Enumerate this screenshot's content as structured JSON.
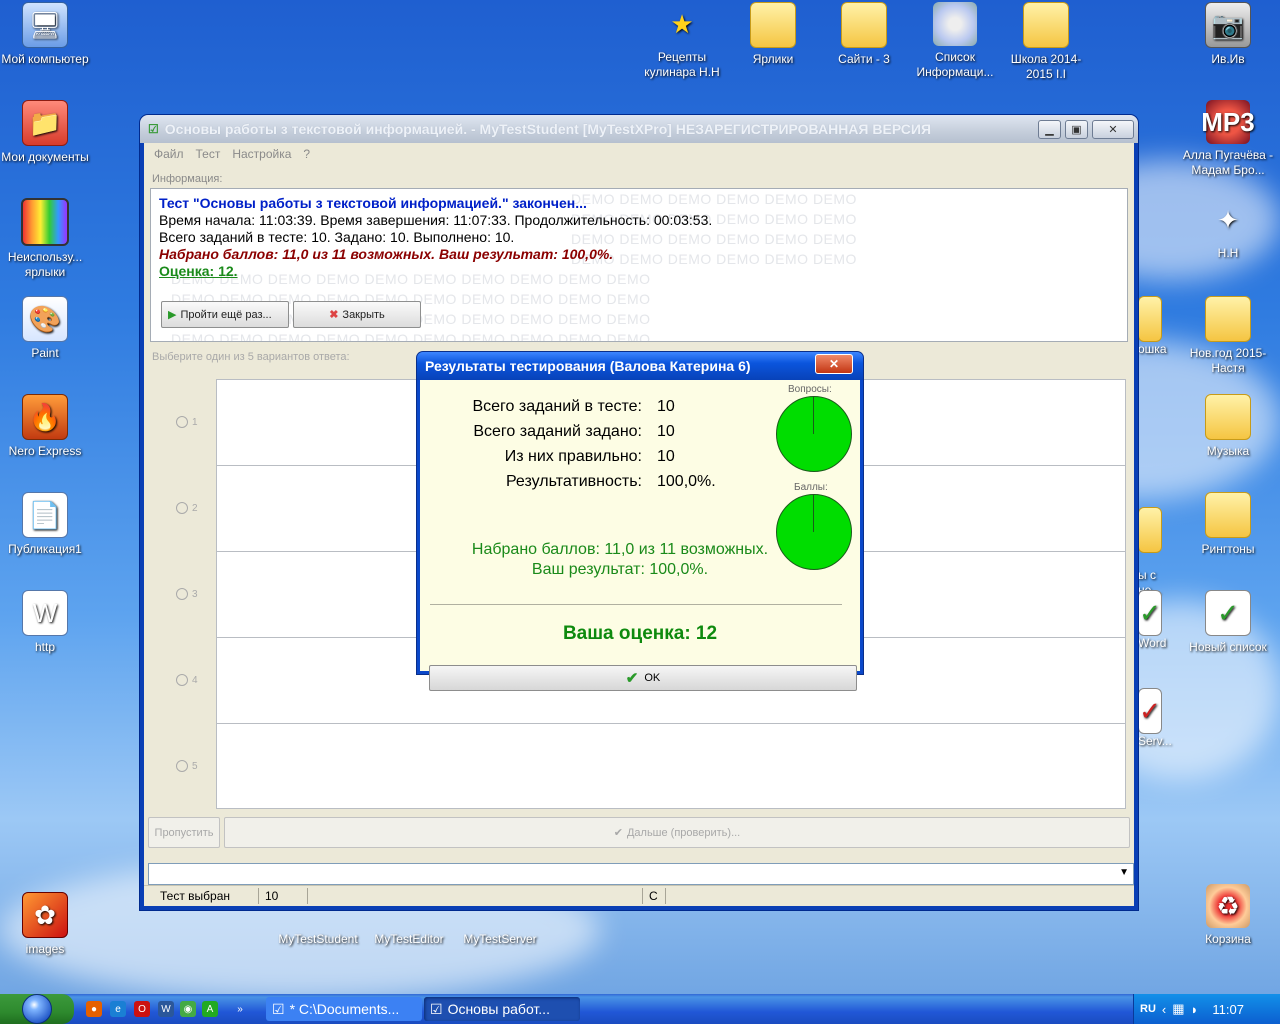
{
  "desktop": {
    "left_icons": [
      {
        "label": "Мой компьютер",
        "icon": "computer-icon"
      },
      {
        "label": "Мои документы",
        "icon": "my-documents-icon"
      },
      {
        "label": "Неиспользу... ярлыки",
        "icon": "unused-shortcuts-icon"
      },
      {
        "label": "Paint",
        "icon": "paint-icon"
      },
      {
        "label": "Nero Express",
        "icon": "nero-icon"
      },
      {
        "label": "Публикация1",
        "icon": "publisher-document-icon"
      },
      {
        "label": "http",
        "icon": "word-document-icon"
      },
      {
        "label": "images",
        "icon": "image-icon"
      }
    ],
    "top_icons": [
      {
        "label": "Рецепты кулинара Н.Н",
        "icon": "star-icon"
      },
      {
        "label": "Ярлики",
        "icon": "folder-icon"
      },
      {
        "label": "Сайти - 3",
        "icon": "folder-icon"
      },
      {
        "label": "Список Информаци...",
        "icon": "cd-icon"
      },
      {
        "label": "Школа 2014-2015 I.I",
        "icon": "folder-icon"
      }
    ],
    "right_icons": [
      {
        "label": "Ив.Ив",
        "icon": "camera-icon"
      },
      {
        "label": "Алла Пугачёва - Мадам Бро...",
        "icon": "mp3-icon"
      },
      {
        "label": "Н.Н",
        "icon": "msn-butterfly-icon"
      },
      {
        "label": "Нов.год 2015-Настя",
        "icon": "folder-icon"
      },
      {
        "label": "Музыка",
        "icon": "folder-icon"
      },
      {
        "label": "Рингтоны",
        "icon": "folder-icon"
      },
      {
        "label": "Новый список",
        "icon": "checklist-icon"
      },
      {
        "label": "Корзина",
        "icon": "recycle-bin-icon"
      }
    ],
    "partial_icons": [
      "ошка",
      "ы с\nне...",
      "Word",
      "Serv..."
    ],
    "bottom_icons": [
      {
        "label": "MyTestStudent"
      },
      {
        "label": "MyTestEditor"
      },
      {
        "label": "MyTestServer"
      }
    ]
  },
  "window": {
    "title": "Основы работы з текстовой информацией. - MyTestStudent [MyTestXPro] НЕЗАРЕГИСТРИРОВАННАЯ ВЕРСИЯ",
    "menu": [
      "Файл",
      "Тест",
      "Настройка",
      "?"
    ],
    "info_label": "Информация:",
    "info": {
      "line1": "Тест \"Основы работы з текстовой информацией.\" закончен...",
      "line2": "Время начала: 11:03:39. Время завершения: 11:07:33. Продолжительность: 00:03:53.",
      "line3": "Всего заданий в тесте: 10. Задано: 10. Выполнено: 10.",
      "line4": "Набрано баллов: 11,0 из 11 возможных. Ваш результат: 100,0%.",
      "line5": "Оценка: 12."
    },
    "demo_watermark": "DEMO",
    "retry_button": "Пройти ещё раз...",
    "close_button": "Закрыть",
    "choose_label": "Выберите один из 5 вариантов ответа:",
    "answer_numbers": [
      "1",
      "2",
      "3",
      "4",
      "5"
    ],
    "skip_button": "Пропустить",
    "next_button": "Дальше (проверить)...",
    "status": {
      "test_selected": "Тест выбран",
      "count": "10",
      "extra": "С"
    }
  },
  "dialog": {
    "title": "Результаты тестирования (Валова Катерина 6)",
    "rows": [
      {
        "label": "Всего заданий в тесте:",
        "value": "10"
      },
      {
        "label": "Всего заданий задано:",
        "value": "10"
      },
      {
        "label": "Из них правильно:",
        "value": "10"
      },
      {
        "label": "Результативность:",
        "value": "100,0%."
      }
    ],
    "pie1_label": "Вопросы:",
    "pie2_label": "Баллы:",
    "score_line1": "Набрано баллов: 11,0 из 11 возможных.",
    "score_line2": "Ваш результат: 100,0%.",
    "grade": "Ваша оценка: 12",
    "ok": "OK",
    "pie_color": "#00dd00"
  },
  "taskbar": {
    "tasks": [
      "* C:\\Documents...",
      "Основы работ..."
    ],
    "lang": "RU",
    "time": "11:07"
  }
}
